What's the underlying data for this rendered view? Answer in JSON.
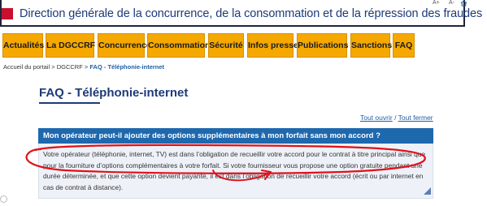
{
  "header": {
    "title": "Direction générale de la concurrence, de la consommation et de la répression des fraudes",
    "font_increase": "A+",
    "font_decrease": "A-"
  },
  "nav": {
    "items": [
      {
        "label": "Actualités"
      },
      {
        "label": "La DGCCRF"
      },
      {
        "label": "Concurrence"
      },
      {
        "label": "Consommation"
      },
      {
        "label": "Sécurité"
      },
      {
        "label": "Infos presse"
      },
      {
        "label": "Publications"
      },
      {
        "label": "Sanctions"
      },
      {
        "label": "FAQ"
      }
    ],
    "accent_color": "#f5a800"
  },
  "breadcrumb": {
    "home": "Accueil du portail",
    "separator": ">",
    "parent": "DGCCRF",
    "current": "FAQ - Téléphonie-internet"
  },
  "page": {
    "title": "FAQ - Téléphonie-internet",
    "open_all": "Tout ouvrir",
    "toggle_separator": "/",
    "close_all": "Tout fermer"
  },
  "faq": {
    "question": "Mon opérateur peut-il ajouter des options supplémentaires à mon forfait sans mon accord ?",
    "answer": "Votre opérateur (téléphonie, internet, TV) est dans l’obligation de recueillir votre accord pour le contrat à titre principal ainsi que pour la fourniture d’options complémentaires à votre forfait. Si votre fournisseur vous propose une option gratuite pendant une durée déterminée, et que cette option devient payante, il est dans l’obligation de recueillir votre accord (écrit ou par internet en cas de contrat à distance).",
    "question_bg": "#1e68ae",
    "annotation_color": "#e0101a"
  }
}
